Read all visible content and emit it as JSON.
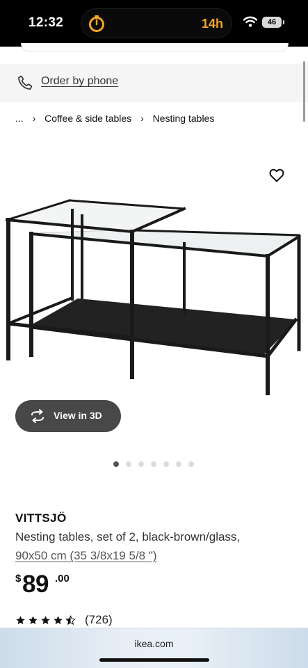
{
  "status_bar": {
    "time": "12:32",
    "activity_text": "14h",
    "battery": "46",
    "activity_color": "#f5a623"
  },
  "order": {
    "link_label": "Order by phone"
  },
  "breadcrumb": {
    "ellipsis": "...",
    "items": [
      "Coffee & side tables",
      "Nesting tables"
    ]
  },
  "media": {
    "view3d_label": "View in 3D",
    "carousel": {
      "count": 7,
      "active_index": 0
    }
  },
  "product": {
    "name": "VITTSJÖ",
    "description": "Nesting tables, set of 2, black-brown/glass,",
    "size": "90x50 cm (35 3/8x19 5/8 \")",
    "price": {
      "currency": "$",
      "integer": "89",
      "decimal": ".00"
    },
    "rating": {
      "stars": 4.5,
      "count": "(726)"
    }
  },
  "browser": {
    "url": "ikea.com"
  },
  "icons": [
    "timer-icon",
    "wifi-icon",
    "phone-icon",
    "chevron-right-icon",
    "heart-icon",
    "rotate-3d-icon",
    "star-icon"
  ]
}
